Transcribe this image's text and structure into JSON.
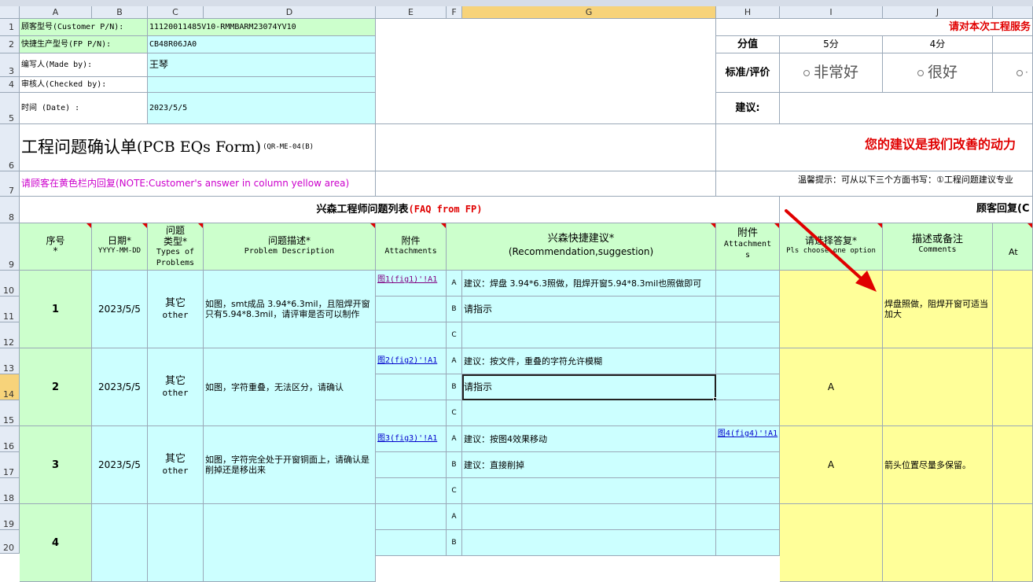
{
  "columns": [
    "A",
    "B",
    "C",
    "D",
    "E",
    "F",
    "G",
    "H",
    "I",
    "J"
  ],
  "rows": [
    "1",
    "2",
    "3",
    "4",
    "5",
    "6",
    "7",
    "8",
    "9",
    "10",
    "11",
    "12",
    "13",
    "14",
    "15",
    "16",
    "17",
    "18",
    "19",
    "20"
  ],
  "header": {
    "customer_pn_label": "顾客型号(Customer P/N):",
    "customer_pn_value": "11120011485V10-RMMBARM23074YV10",
    "fp_pn_label": "快捷生产型号(FP P/N):",
    "fp_pn_value": "CB48R06JA0",
    "made_by_label": "编写人(Made by):",
    "made_by_value": "王琴",
    "checked_by_label": "审核人(Checked by):",
    "checked_by_value": "",
    "date_label": "时间 (Date) :",
    "date_value": "2023/5/5",
    "form_title_cn": "工程问题确认单",
    "form_title_en": "(PCB EQs Form)",
    "form_code": "(QR-ME-04(B)",
    "note": "请顾客在黄色栏内回复(NOTE:Customer's answer in column yellow area)"
  },
  "survey": {
    "prompt": "请对本次工程服务",
    "score_label": "分值",
    "score_5": "5分",
    "score_4": "4分",
    "eval_label": "标准/评价",
    "opt_5": "非常好",
    "opt_4": "很好",
    "opt_3": "·",
    "suggest_label": "建议:",
    "slogan": "您的建议是我们改善的动力",
    "tip": "温馨提示：可从以下三个方面书写：①工程问题建议专业"
  },
  "sections": {
    "fp_title": "兴森工程师问题列表",
    "fp_title_en": "(FAQ from FP)",
    "customer_title": "顾客回复(C"
  },
  "table_headers": {
    "seq": "序号",
    "seq_star": "*",
    "date": "日期*",
    "date_fmt": "YYYY-MM-DD",
    "type_cn": "问题",
    "type_cn2": "类型*",
    "type_en": "Types of",
    "type_en2": "Problems",
    "desc_cn": "问题描述*",
    "desc_en": "Problem Description",
    "attach_cn": "附件",
    "attach_en": "Attachments",
    "rec_cn": "兴森快捷建议*",
    "rec_en": "(Recommendation,suggestion)",
    "attach2_cn": "附件",
    "attach2_en": "Attachment",
    "attach2_en2": "s",
    "choose_cn": "请选择答复*",
    "choose_en": "Pls choose one option",
    "comments_cn": "描述或备注",
    "comments_en": "Comments",
    "at": "At"
  },
  "problems": [
    {
      "seq": "1",
      "date": "2023/5/5",
      "type_cn": "其它",
      "type_en": "other",
      "desc": "如图，smt成品 3.94*6.3mil，且阻焊开窗只有5.94*8.3mil，请评审是否可以制作",
      "attach": "图1(fig1)'!A1",
      "opt_a": "建议：焊盘 3.94*6.3照做，阻焊开窗5.94*8.3mil也照做即可",
      "opt_b": "请指示",
      "opt_c": "",
      "attach2": "",
      "choice": "",
      "comment": "焊盘照做，阻焊开窗可适当加大"
    },
    {
      "seq": "2",
      "date": "2023/5/5",
      "type_cn": "其它",
      "type_en": "other",
      "desc": "如图，字符重叠，无法区分，请确认",
      "attach": "图2(fig2)'!A1",
      "opt_a": "建议：按文件，重叠的字符允许模糊",
      "opt_b": "请指示",
      "opt_c": "",
      "attach2": "",
      "choice": "A",
      "comment": ""
    },
    {
      "seq": "3",
      "date": "2023/5/5",
      "type_cn": "其它",
      "type_en": "other",
      "desc": "如图，字符完全处于开窗铜面上，请确认是削掉还是移出来",
      "attach": "图3(fig3)'!A1",
      "opt_a": "建议：按图4效果移动",
      "opt_b": "建议：直接削掉",
      "opt_c": "",
      "attach2": "图4(fig4)'!A1",
      "choice": "A",
      "comment": "箭头位置尽量多保留。"
    },
    {
      "seq": "4",
      "date": "",
      "type_cn": "",
      "type_en": "",
      "desc": "",
      "attach": "",
      "opt_a": "",
      "opt_b": "",
      "opt_c": "",
      "attach2": "",
      "choice": "",
      "comment": ""
    }
  ],
  "option_letters": [
    "A",
    "B",
    "C"
  ],
  "colors": {
    "green": "#ccffcc",
    "cyan": "#ccffff",
    "yellow": "#ffff99",
    "arrow": "#e00000",
    "slogan": "#e00000"
  }
}
